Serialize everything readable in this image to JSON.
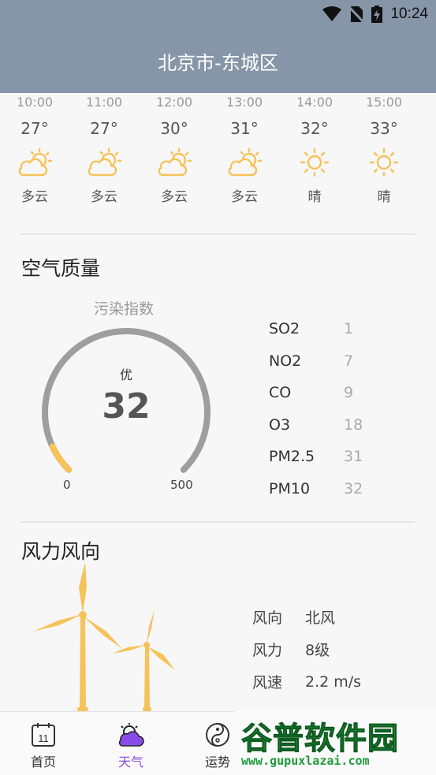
{
  "status_bar": {
    "time": "10:24",
    "icons": [
      "wifi-icon",
      "no-sim-icon",
      "battery-charging-icon"
    ]
  },
  "header": {
    "title": "北京市-东城区"
  },
  "hourly": [
    {
      "time": "10:00",
      "temp": "27°",
      "condition": "多云",
      "icon": "partly-cloudy-icon"
    },
    {
      "time": "11:00",
      "temp": "27°",
      "condition": "多云",
      "icon": "partly-cloudy-icon"
    },
    {
      "time": "12:00",
      "temp": "30°",
      "condition": "多云",
      "icon": "partly-cloudy-icon"
    },
    {
      "time": "13:00",
      "temp": "31°",
      "condition": "多云",
      "icon": "partly-cloudy-icon"
    },
    {
      "time": "14:00",
      "temp": "32°",
      "condition": "晴",
      "icon": "sunny-icon"
    },
    {
      "time": "15:00",
      "temp": "33°",
      "condition": "晴",
      "icon": "sunny-icon"
    }
  ],
  "air_quality": {
    "title": "空气质量",
    "gauge": {
      "caption": "污染指数",
      "level": "优",
      "value": 32,
      "min": 0,
      "max": 500
    },
    "pollutants": [
      {
        "name": "SO2",
        "value": "1"
      },
      {
        "name": "NO2",
        "value": "7"
      },
      {
        "name": "CO",
        "value": "9"
      },
      {
        "name": "O3",
        "value": "18"
      },
      {
        "name": "PM2.5",
        "value": "31"
      },
      {
        "name": "PM10",
        "value": "32"
      }
    ]
  },
  "wind": {
    "title": "风力风向",
    "rows": [
      {
        "label": "风向",
        "value": "北风"
      },
      {
        "label": "风力",
        "value": "8级"
      },
      {
        "label": "风速",
        "value": "2.2 m/s"
      }
    ]
  },
  "bottom_nav": [
    {
      "label": "首页",
      "icon": "calendar-icon",
      "active": false
    },
    {
      "label": "天气",
      "icon": "weather-icon",
      "active": true
    },
    {
      "label": "运势",
      "icon": "yin-yang-icon",
      "active": false
    }
  ],
  "calendar_icon_day": "11",
  "watermark": {
    "text": "谷普软件园",
    "url": "www.gupuxlazai.com"
  },
  "colors": {
    "header": "#8795a8",
    "accent": "#f6c25a",
    "gauge_track": "#9e9e9e",
    "nav_active": "#8a4ce8"
  }
}
